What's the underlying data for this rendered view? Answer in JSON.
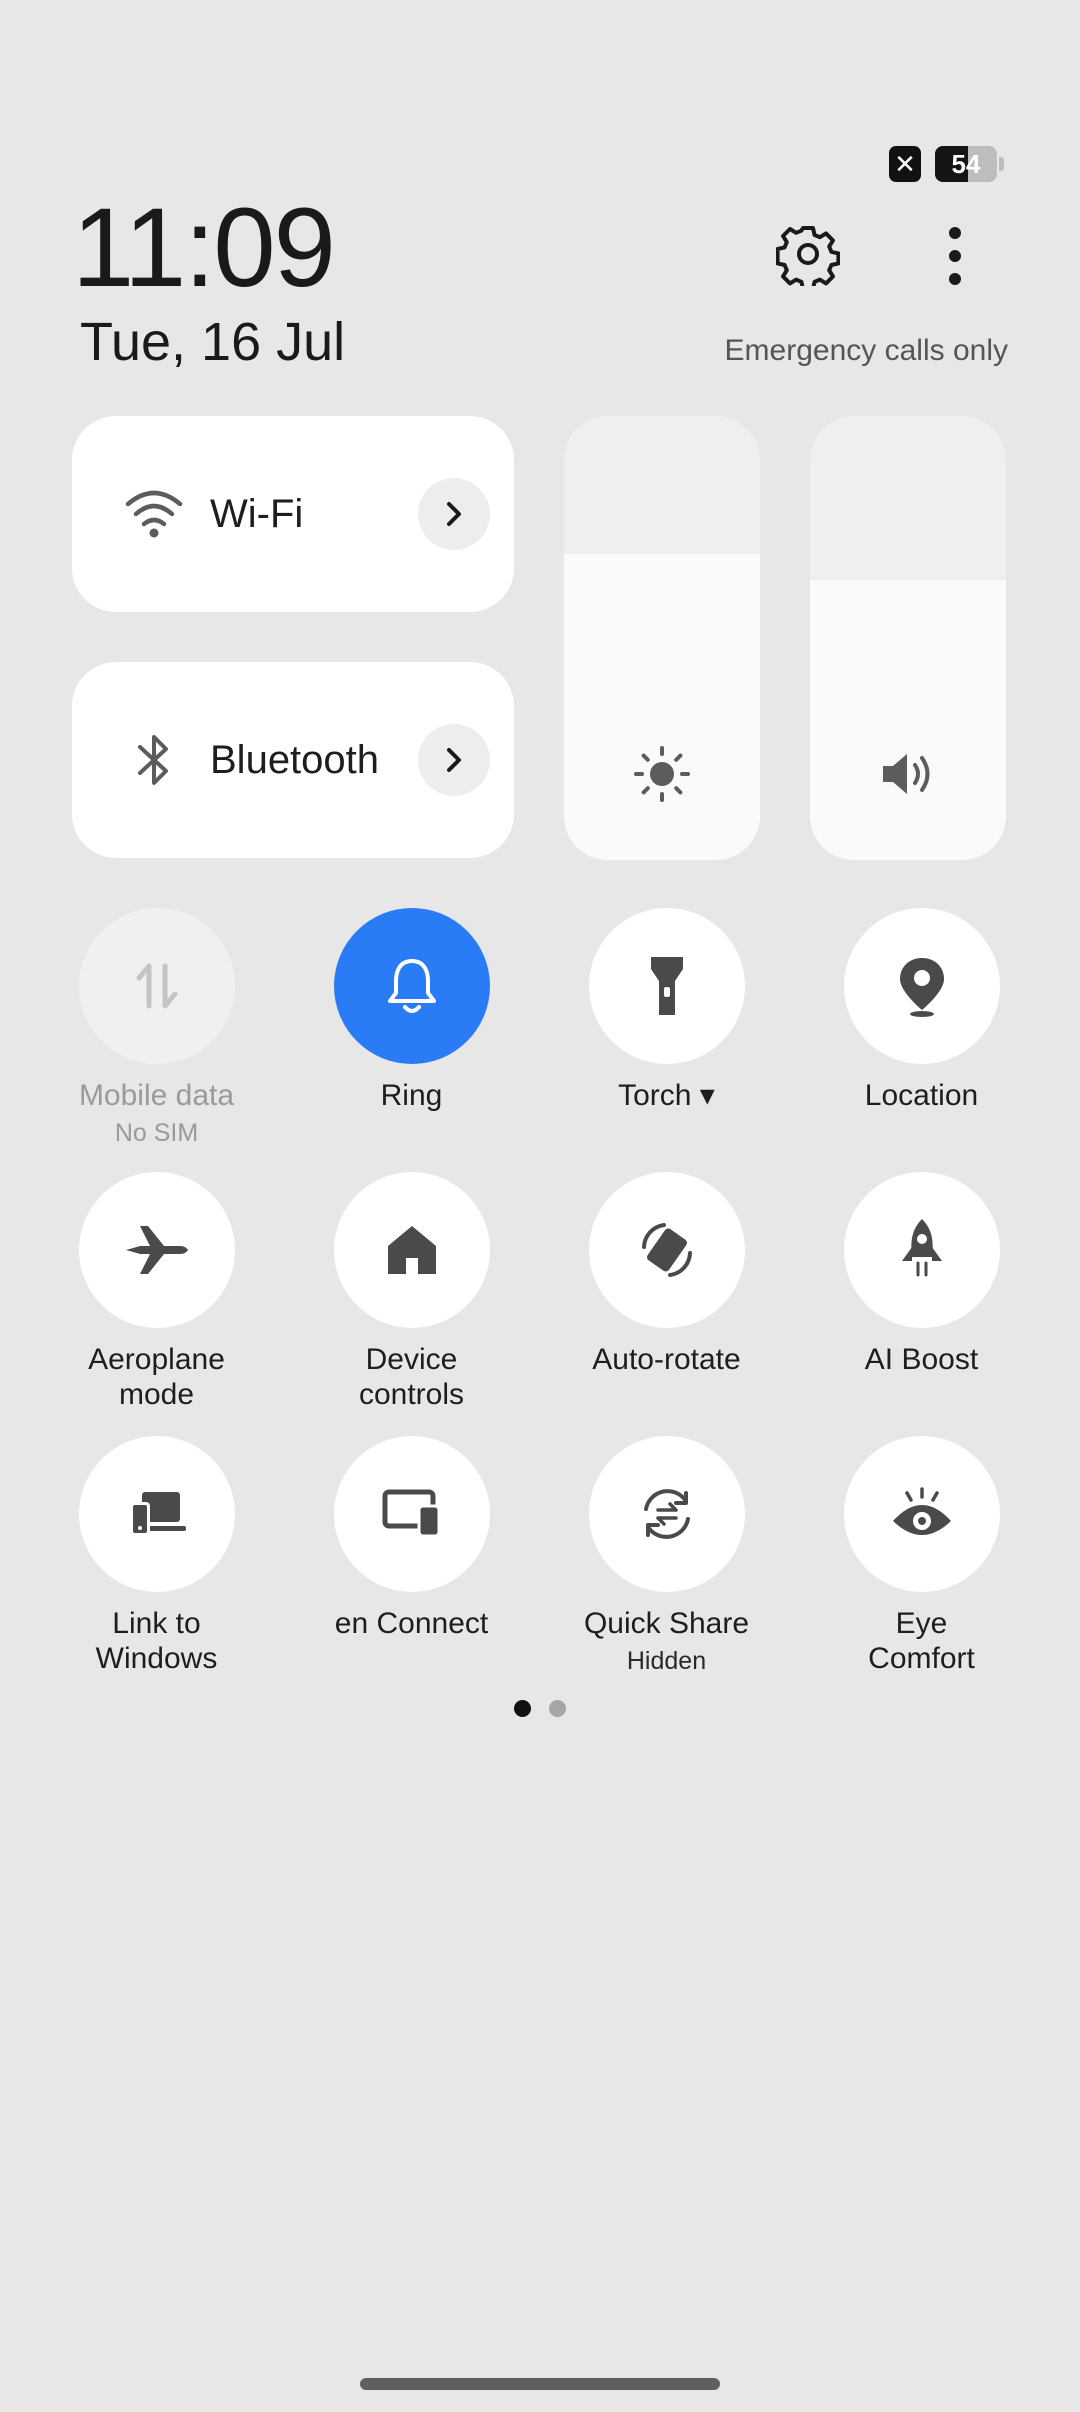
{
  "status_bar": {
    "sim_icon": "sim-absent-icon",
    "battery_level": "54",
    "battery_fraction": 0.54
  },
  "header": {
    "time": "11:09",
    "date": "Tue, 16 Jul",
    "network_status": "Emergency calls only",
    "settings_icon": "gear-icon",
    "more_icon": "more-vertical-icon"
  },
  "cards": {
    "wifi": {
      "label": "Wi-Fi",
      "icon": "wifi-icon"
    },
    "bluetooth": {
      "label": "Bluetooth",
      "icon": "bluetooth-icon"
    }
  },
  "sliders": {
    "brightness": {
      "icon": "brightness-icon",
      "level": 0.69
    },
    "volume": {
      "icon": "volume-icon",
      "level": 0.63
    }
  },
  "tiles": [
    {
      "label": "Mobile data",
      "sub": "No SIM",
      "icon": "mobile-data-icon",
      "state": "disabled"
    },
    {
      "label": "Ring",
      "sub": "",
      "icon": "bell-icon",
      "state": "active"
    },
    {
      "label": "Torch ▾",
      "sub": "",
      "icon": "torch-icon",
      "state": "off"
    },
    {
      "label": "Location",
      "sub": "",
      "icon": "location-pin-icon",
      "state": "off"
    },
    {
      "label": "Aeroplane\nmode",
      "sub": "",
      "icon": "airplane-icon",
      "state": "off"
    },
    {
      "label": "Device\ncontrols",
      "sub": "",
      "icon": "home-icon",
      "state": "off"
    },
    {
      "label": "Auto-rotate",
      "sub": "",
      "icon": "auto-rotate-icon",
      "state": "off"
    },
    {
      "label": "AI Boost",
      "sub": "",
      "icon": "rocket-icon",
      "state": "off"
    },
    {
      "label": "Link to\nWindows",
      "sub": "",
      "icon": "link-to-windows-icon",
      "state": "off"
    },
    {
      "label": "en Connect",
      "sub": "",
      "icon": "screen-connect-icon",
      "state": "off"
    },
    {
      "label": "Quick Share",
      "sub": "Hidden",
      "icon": "quick-share-icon",
      "state": "off"
    },
    {
      "label": "Eye\nComfort",
      "sub": "",
      "icon": "eye-icon",
      "state": "off"
    }
  ],
  "pager": {
    "pages": 2,
    "current": 1
  }
}
